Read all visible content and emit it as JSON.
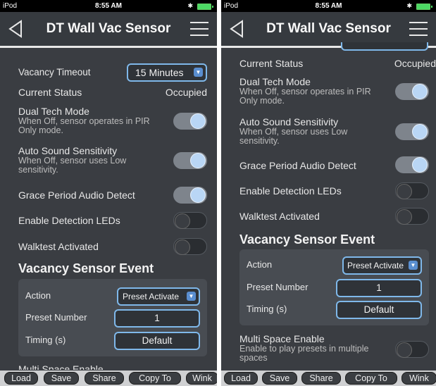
{
  "status_bar": {
    "carrier": "iPod",
    "time": "8:55 AM",
    "bluetooth": "✱"
  },
  "nav": {
    "title": "DT Wall Vac Sensor",
    "back_icon": "back-arrow-icon",
    "menu_icon": "hamburger-menu-icon"
  },
  "settings": {
    "vacancy_timeout_label": "Vacancy Timeout",
    "vacancy_timeout_value": "15 Minutes",
    "current_status_label": "Current Status",
    "current_status_value": "Occupied",
    "dual_tech_label": "Dual Tech Mode",
    "dual_tech_sub": "When Off, sensor operates in PIR Only mode.",
    "dual_tech_on": true,
    "auto_sound_label": "Auto Sound Sensitivity",
    "auto_sound_sub": "When Off, sensor uses Low sensitivity.",
    "auto_sound_on": true,
    "grace_period_label": "Grace Period Audio Detect",
    "grace_period_on": true,
    "detection_leds_label": "Enable Detection LEDs",
    "detection_leds_on": false,
    "walktest_label": "Walktest Activated",
    "walktest_on": false
  },
  "event": {
    "title": "Vacancy Sensor Event",
    "action_label": "Action",
    "action_value": "Preset Activate",
    "preset_label": "Preset Number",
    "preset_value": "1",
    "timing_label": "Timing (s)",
    "timing_value": "Default"
  },
  "multi_space": {
    "label": "Multi Space Enable",
    "sub": "Enable to play presets in multiple spaces",
    "on": false,
    "partial_label": "Multi Space Enable"
  },
  "bottom_bar": {
    "load": "Load",
    "save": "Save",
    "share": "Share",
    "copy_to": "Copy To",
    "wink": "Wink"
  },
  "colors": {
    "background": "#3a3d42",
    "accent": "#7fb8ea",
    "toggle_knob_on": "#b9d6f5"
  }
}
